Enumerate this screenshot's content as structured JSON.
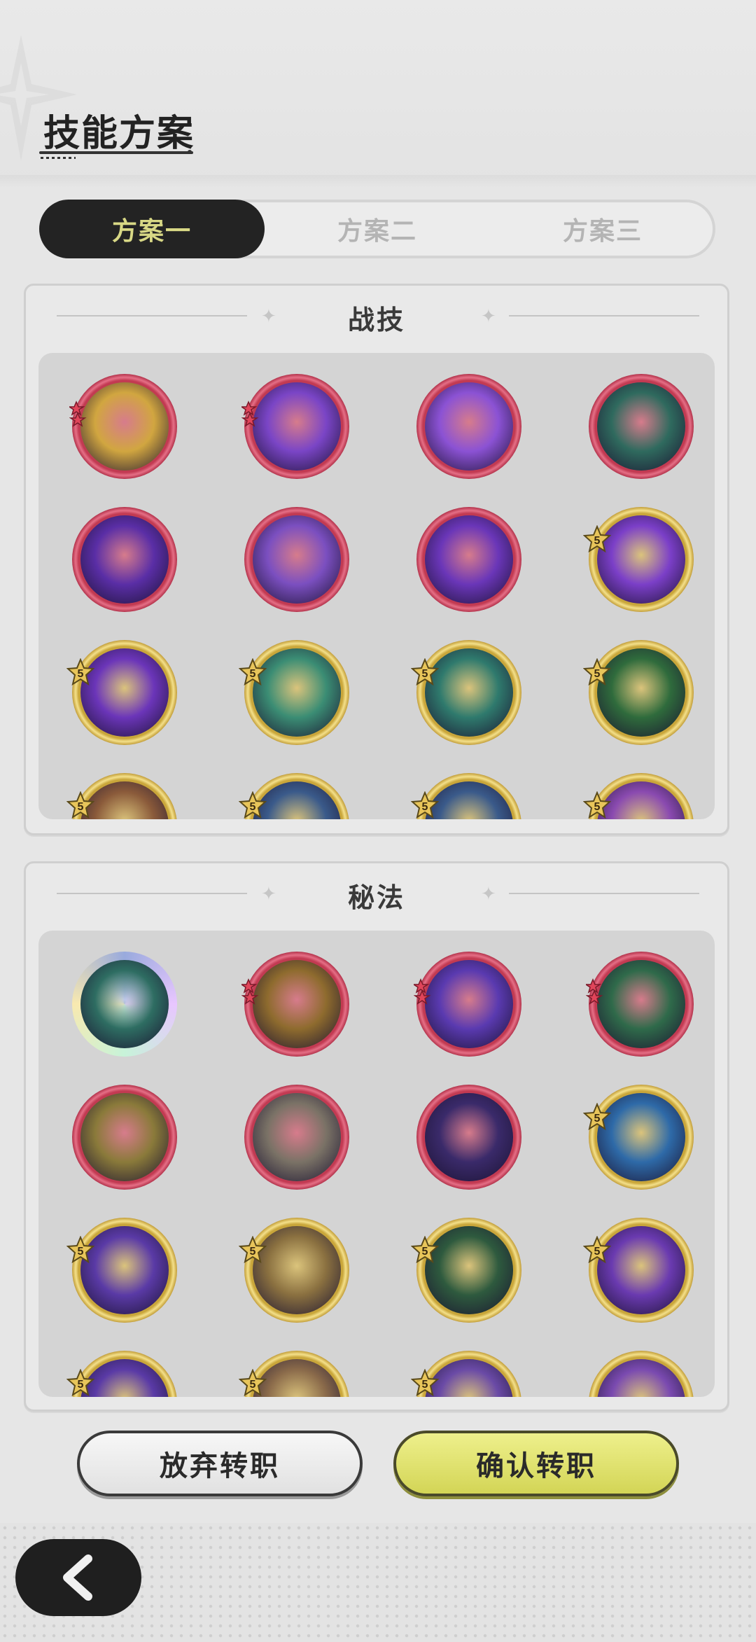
{
  "header": {
    "title": "技能方案"
  },
  "tabs": [
    {
      "label": "方案一",
      "active": true
    },
    {
      "label": "方案二",
      "active": false
    },
    {
      "label": "方案三",
      "active": false
    }
  ],
  "sections": [
    {
      "title": "战技",
      "rows": [
        [
          {
            "name": "totem-skill-icon",
            "frame": "red",
            "badge": "red-stars",
            "art": "#d1a640"
          },
          {
            "name": "throne-skill-icon",
            "frame": "red",
            "badge": "red-stars",
            "art": "#7a45c6"
          },
          {
            "name": "shatter-skill-icon",
            "frame": "red",
            "badge": "",
            "art": "#8b52d4"
          },
          {
            "name": "spirit-skill-icon",
            "frame": "red",
            "badge": "",
            "art": "#2f6a5e"
          }
        ],
        [
          {
            "name": "vortex-skill-icon",
            "frame": "red",
            "badge": "",
            "art": "#5a2ea6"
          },
          {
            "name": "eye-sigil-skill-icon",
            "frame": "red",
            "badge": "",
            "art": "#7b4fc0"
          },
          {
            "name": "heart-shield-skill-icon",
            "frame": "red",
            "badge": "",
            "art": "#6a36b8"
          },
          {
            "name": "flame-orb-skill-icon",
            "frame": "gold",
            "badge": "5",
            "art": "#7b3fc8"
          }
        ],
        [
          {
            "name": "star-burst-skill-icon",
            "frame": "gold",
            "badge": "5",
            "art": "#6b35b9"
          },
          {
            "name": "wind-blade-skill-icon",
            "frame": "gold",
            "badge": "5",
            "art": "#3b8d74"
          },
          {
            "name": "spiral-skill-icon",
            "frame": "gold",
            "badge": "5",
            "art": "#2f7a6d"
          },
          {
            "name": "heal-cross-skill-icon",
            "frame": "gold",
            "badge": "5",
            "art": "#2f6b3c"
          }
        ],
        [
          {
            "name": "partial-skill-icon-1",
            "frame": "gold",
            "badge": "5",
            "art": "#8a5a3a"
          },
          {
            "name": "partial-skill-icon-2",
            "frame": "gold",
            "badge": "5",
            "art": "#3a5a8a"
          },
          {
            "name": "partial-skill-icon-3",
            "frame": "gold",
            "badge": "5",
            "art": "#3a5a8a"
          },
          {
            "name": "partial-skill-icon-4",
            "frame": "gold",
            "badge": "5",
            "art": "#8a4ab0"
          }
        ]
      ]
    },
    {
      "title": "秘法",
      "rows": [
        [
          {
            "name": "spirit-aura-secret-icon",
            "frame": "rainbow",
            "badge": "",
            "art": "#2e6d62"
          },
          {
            "name": "golden-prayer-secret-icon",
            "frame": "red",
            "badge": "red-stars",
            "art": "#8e6b2e"
          },
          {
            "name": "strength-secret-icon",
            "frame": "red",
            "badge": "red-stars",
            "art": "#5a3ab0"
          },
          {
            "name": "rune-field-secret-icon",
            "frame": "red",
            "badge": "red-stars",
            "art": "#2f6a4a"
          }
        ],
        [
          {
            "name": "rising-flame-secret-icon",
            "frame": "red",
            "badge": "",
            "art": "#8a7a3a"
          },
          {
            "name": "ghost-figure-secret-icon",
            "frame": "red",
            "badge": "",
            "art": "#7a7266"
          },
          {
            "name": "arcane-eye-secret-icon",
            "frame": "red",
            "badge": "",
            "art": "#3a2a6a"
          },
          {
            "name": "ice-crystal-secret-icon",
            "frame": "gold",
            "badge": "5",
            "art": "#2e6aa8"
          }
        ],
        [
          {
            "name": "heart-void-secret-icon",
            "frame": "gold",
            "badge": "5",
            "art": "#5a3aa6"
          },
          {
            "name": "beast-rush-secret-icon",
            "frame": "gold",
            "badge": "5",
            "art": "#8a7040"
          },
          {
            "name": "green-cube-secret-icon",
            "frame": "gold",
            "badge": "5",
            "art": "#2e5a3e"
          },
          {
            "name": "swirl-secret-icon",
            "frame": "gold",
            "badge": "5",
            "art": "#6a3ab0"
          }
        ],
        [
          {
            "name": "partial-secret-icon-1",
            "frame": "gold",
            "badge": "5",
            "art": "#5a3aa6"
          },
          {
            "name": "partial-secret-icon-2",
            "frame": "gold",
            "badge": "5",
            "art": "#8a6a4a"
          },
          {
            "name": "partial-secret-icon-3",
            "frame": "gold",
            "badge": "5",
            "art": "#6a4aa6"
          },
          {
            "name": "partial-secret-icon-4",
            "frame": "gold",
            "badge": "",
            "art": "#7a4ab0"
          }
        ]
      ]
    }
  ],
  "buttons": {
    "cancel": "放弃转职",
    "confirm": "确认转职"
  },
  "colors": {
    "active_tab_bg": "#232323",
    "active_tab_text": "#d8d885",
    "confirm_bg": "#d3d556",
    "red_frame": "#c23a52",
    "gold_frame": "#c9a63a"
  }
}
